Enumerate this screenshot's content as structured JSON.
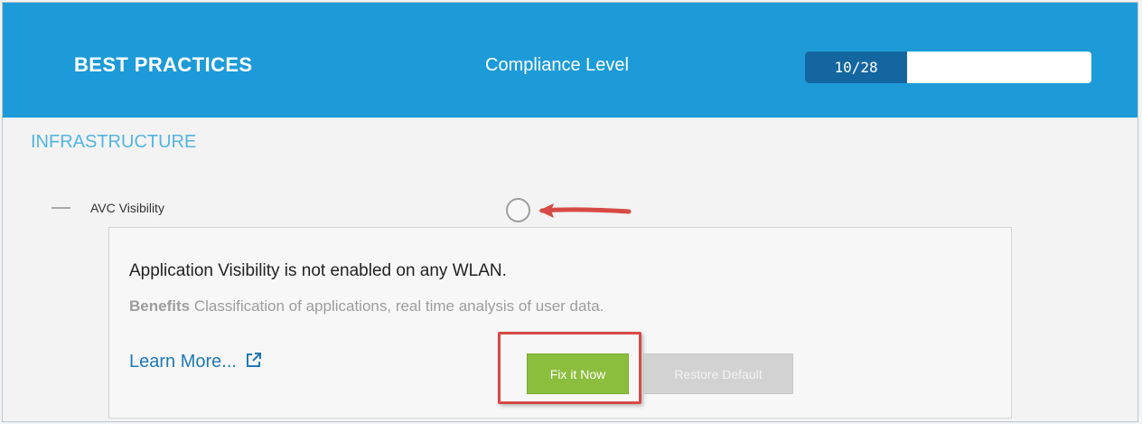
{
  "header": {
    "title": "BEST PRACTICES",
    "compliance_label": "Compliance Level",
    "compliance_value": "10/28",
    "compliance_fraction": 0.3571
  },
  "section": {
    "title": "INFRASTRUCTURE"
  },
  "item": {
    "label": "AVC Visibility",
    "status": "not-compliant"
  },
  "card": {
    "message": "Application Visibility is not enabled on any WLAN.",
    "benefits_label": "Benefits",
    "benefits_text": "Classification of applications, real time analysis of user data.",
    "learn_more": "Learn More...",
    "fix_button": "Fix it Now",
    "restore_button": "Restore Default"
  },
  "icons": {
    "collapse": "minus-icon",
    "status": "empty-circle-icon",
    "annotation": "red-arrow-icon",
    "external_link": "external-link-icon"
  },
  "colors": {
    "header": "#1d9bd8",
    "progress": "#1466a1",
    "section": "#53b5e1",
    "fix_button": "#8cbe3d",
    "highlight": "#d64a45"
  }
}
